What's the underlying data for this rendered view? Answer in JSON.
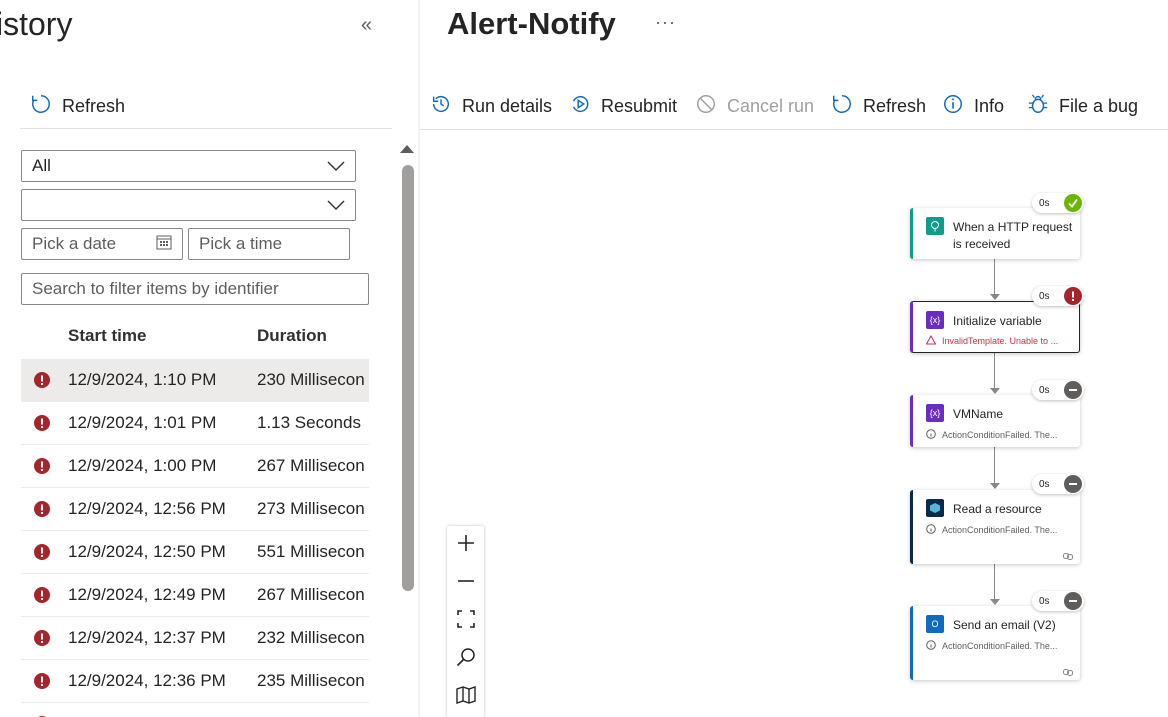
{
  "history_panel": {
    "title": "istory",
    "collapse_glyph": "«",
    "refresh_label": "Refresh",
    "status_filter": "All",
    "second_filter": "",
    "date_placeholder": "Pick a date",
    "time_placeholder": "Pick a time",
    "search_placeholder": "Search to filter items by identifier",
    "columns": [
      "Start time",
      "Duration"
    ],
    "runs": [
      {
        "status": "failed",
        "start": "12/9/2024, 1:10 PM",
        "duration": "230 Millisecon",
        "selected": true
      },
      {
        "status": "failed",
        "start": "12/9/2024, 1:01 PM",
        "duration": "1.13 Seconds"
      },
      {
        "status": "failed",
        "start": "12/9/2024, 1:00 PM",
        "duration": "267 Millisecon"
      },
      {
        "status": "failed",
        "start": "12/9/2024, 12:56 PM",
        "duration": "273 Millisecon"
      },
      {
        "status": "failed",
        "start": "12/9/2024, 12:50 PM",
        "duration": "551 Millisecon"
      },
      {
        "status": "failed",
        "start": "12/9/2024, 12:49 PM",
        "duration": "267 Millisecon"
      },
      {
        "status": "failed",
        "start": "12/9/2024, 12:37 PM",
        "duration": "232 Millisecon"
      },
      {
        "status": "failed",
        "start": "12/9/2024, 12:36 PM",
        "duration": "235 Millisecon"
      }
    ]
  },
  "workflow": {
    "title": "Alert-Notify",
    "more_label": "···",
    "toolbar": {
      "run_details": "Run details",
      "resubmit": "Resubmit",
      "cancel_run": "Cancel run",
      "refresh": "Refresh",
      "info": "Info",
      "file_bug": "File a bug"
    },
    "steps": [
      {
        "title_line1": "When a HTTP request",
        "title_line2": "is received",
        "duration": "0s",
        "status": "succeeded",
        "accent": "#0f9d8a",
        "icon": "http-request-icon"
      },
      {
        "title_line1": "Initialize variable",
        "duration": "0s",
        "status": "failed",
        "accent": "#6b2cc2",
        "icon": "variable-icon",
        "message": "InvalidTemplate. Unable to ..."
      },
      {
        "title_line1": "VMName",
        "duration": "0s",
        "status": "skipped",
        "accent": "#6b2cc2",
        "icon": "variable-icon",
        "message": "ActionConditionFailed. The..."
      },
      {
        "title_line1": "Read a resource",
        "duration": "0s",
        "status": "skipped",
        "accent": "#0b2b4a",
        "icon": "azure-resource-icon",
        "message": "ActionConditionFailed. The..."
      },
      {
        "title_line1": "Send an email (V2)",
        "duration": "0s",
        "status": "skipped",
        "accent": "#0f6cbd",
        "icon": "outlook-icon",
        "message": "ActionConditionFailed. The..."
      }
    ]
  },
  "colors": {
    "error": "#a4262c",
    "success": "#6bb700",
    "skipped": "#605e5c",
    "accent": "#0f6cbd",
    "warning_text": "#c4314b"
  }
}
